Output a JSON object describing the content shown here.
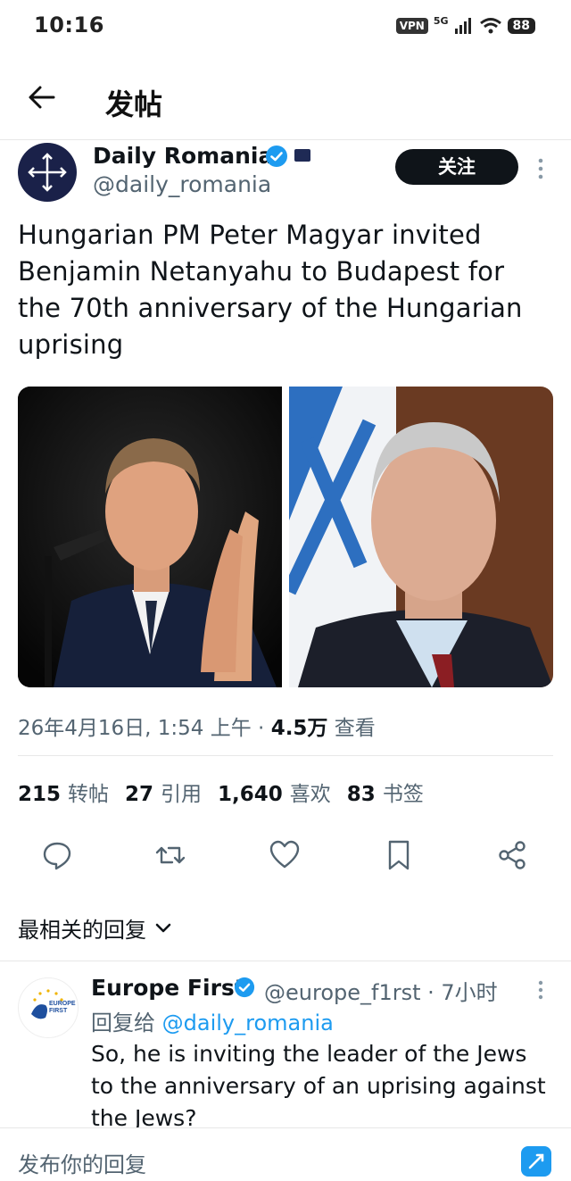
{
  "status_bar": {
    "time": "10:16",
    "vpn": "VPN",
    "network": "5G",
    "battery": "88"
  },
  "header": {
    "title": "发帖"
  },
  "tweet": {
    "author_name": "Daily Romania",
    "author_handle": "@daily_romania",
    "follow_label": "关注",
    "text": "Hungarian PM Peter Magyar invited Benjamin Netanyahu to Budapest for the 70th anniversary of the Hungarian uprising",
    "timestamp": "26年4月16日, 1:54 上午 · ",
    "views_count": "4.5万",
    "views_label": " 查看",
    "stats": [
      {
        "count": "215",
        "label": "转帖"
      },
      {
        "count": "27",
        "label": "引用"
      },
      {
        "count": "1,640",
        "label": "喜欢"
      },
      {
        "count": "83",
        "label": "书签"
      }
    ]
  },
  "actions": [
    "reply-icon",
    "retweet-icon",
    "like-icon",
    "bookmark-icon",
    "share-icon"
  ],
  "replies_section": {
    "title": "最相关的回复"
  },
  "reply": {
    "author_name": "Europe First",
    "author_handle": "@europe_f1rst · 7小时",
    "avatar_text_1": "EUROPE",
    "avatar_text_2": "FIRST",
    "reply_to_prefix": "回复给 ",
    "reply_to_mention": "@daily_romania",
    "text": "So, he is inviting the leader of the Jews to the anniversary of an uprising against the Jews?"
  },
  "composer": {
    "placeholder": "发布你的回复"
  },
  "colors": {
    "accent": "#1d9bf0",
    "text": "#0f1419",
    "muted": "#536471",
    "follow_bg": "#0f1419"
  }
}
